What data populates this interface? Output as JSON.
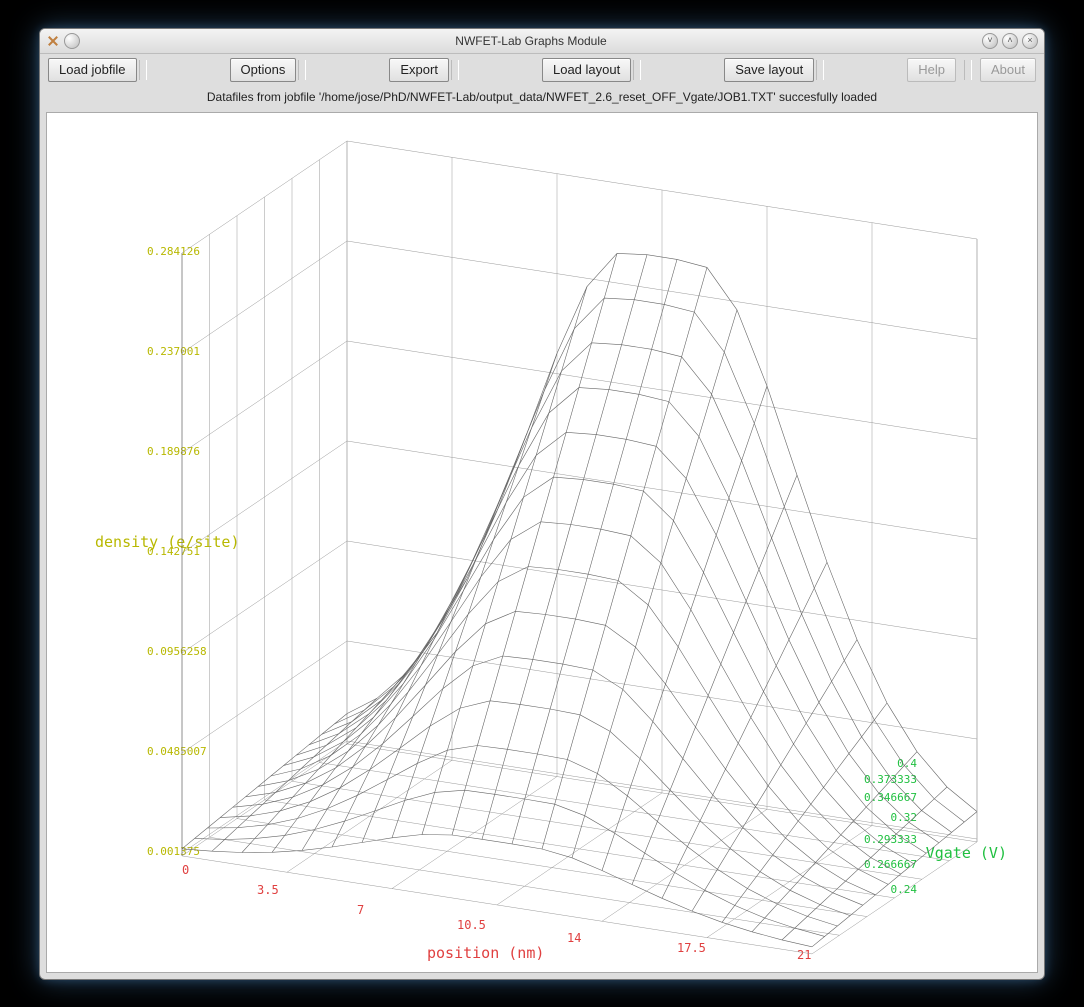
{
  "window": {
    "title": "NWFET-Lab Graphs Module"
  },
  "toolbar": {
    "load_jobfile": "Load jobfile",
    "options": "Options",
    "export": "Export",
    "load_layout": "Load layout",
    "save_layout": "Save layout",
    "help": "Help",
    "about": "About"
  },
  "status": "Datafiles from jobfile '/home/jose/PhD/NWFET-Lab/output_data/NWFET_2.6_reset_OFF_Vgate/JOB1.TXT' succesfully loaded",
  "chart_data": {
    "type": "surface3d",
    "xlabel": "position (nm)",
    "ylabel": "Vgate (V)",
    "zlabel": "density (e/site)",
    "x_ticks": [
      "0",
      "3.5",
      "7",
      "10.5",
      "14",
      "17.5",
      "21"
    ],
    "y_ticks": [
      "0.24",
      "0.266667",
      "0.293333",
      "0.32",
      "0.346667",
      "0.373333",
      "0.4"
    ],
    "z_ticks": [
      "0.001375",
      "0.0485007",
      "0.0956258",
      "0.142751",
      "0.189876",
      "0.237001",
      "0.284126"
    ],
    "x_range": [
      0,
      21
    ],
    "y_range": [
      0.24,
      0.4
    ],
    "z_range": [
      0.001375,
      0.284126
    ],
    "note": "3D wireframe surface; density peaks near center position (~8-12 nm) for higher Vgate, approaching ~0.28; near-zero at edges."
  }
}
